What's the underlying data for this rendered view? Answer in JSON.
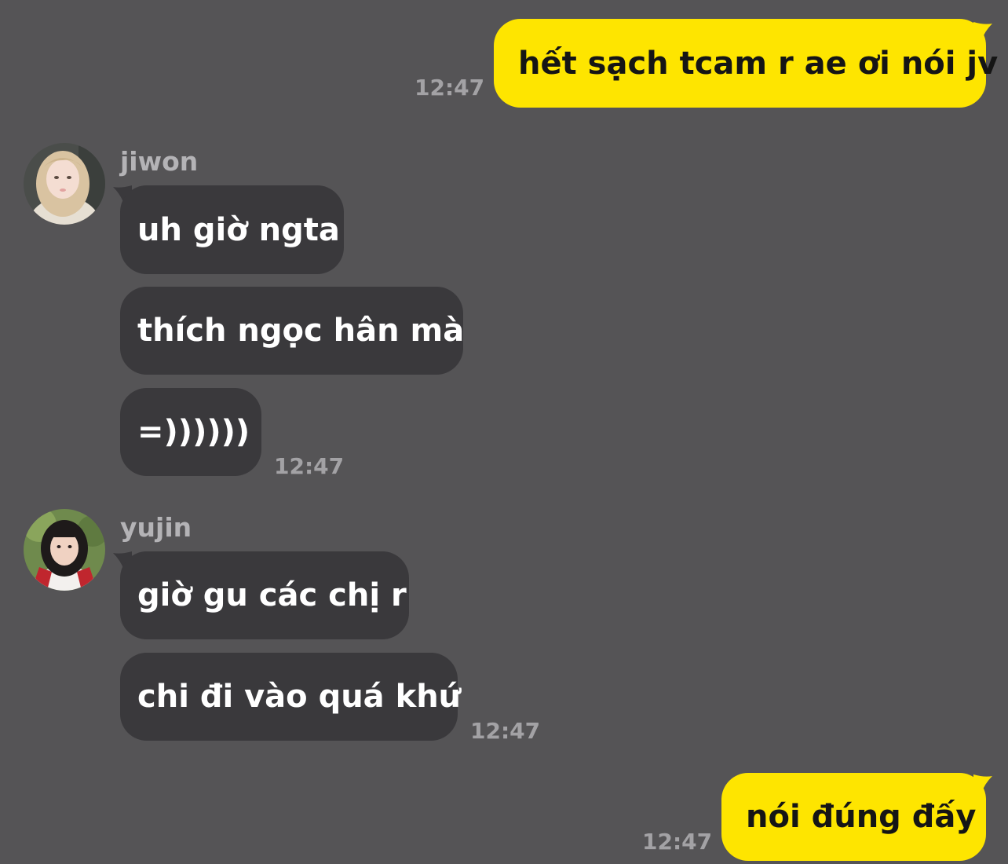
{
  "theme": {
    "background": "#555456",
    "outgoing_bubble": "#fee500",
    "incoming_bubble": "#3a393c",
    "timestamp_color": "#a3a2a5",
    "sender_color": "#b4b3b6"
  },
  "messages": {
    "msg1": {
      "text": "hết sạch tcam r ae ơi nói jv",
      "time": "12:47"
    },
    "jiwon": {
      "name": "jiwon",
      "avatar_icon": "user-photo-blonde",
      "lines": [
        "uh giờ ngta",
        "thích ngọc hân mà",
        "=))))))"
      ],
      "time": "12:47"
    },
    "yujin": {
      "name": "yujin",
      "avatar_icon": "user-photo-dark-hair",
      "lines": [
        "giờ gu các chị r",
        "chi đi vào quá khứ"
      ],
      "time": "12:47"
    },
    "msg_last": {
      "text": "nói đúng đấy",
      "time": "12:47"
    }
  }
}
